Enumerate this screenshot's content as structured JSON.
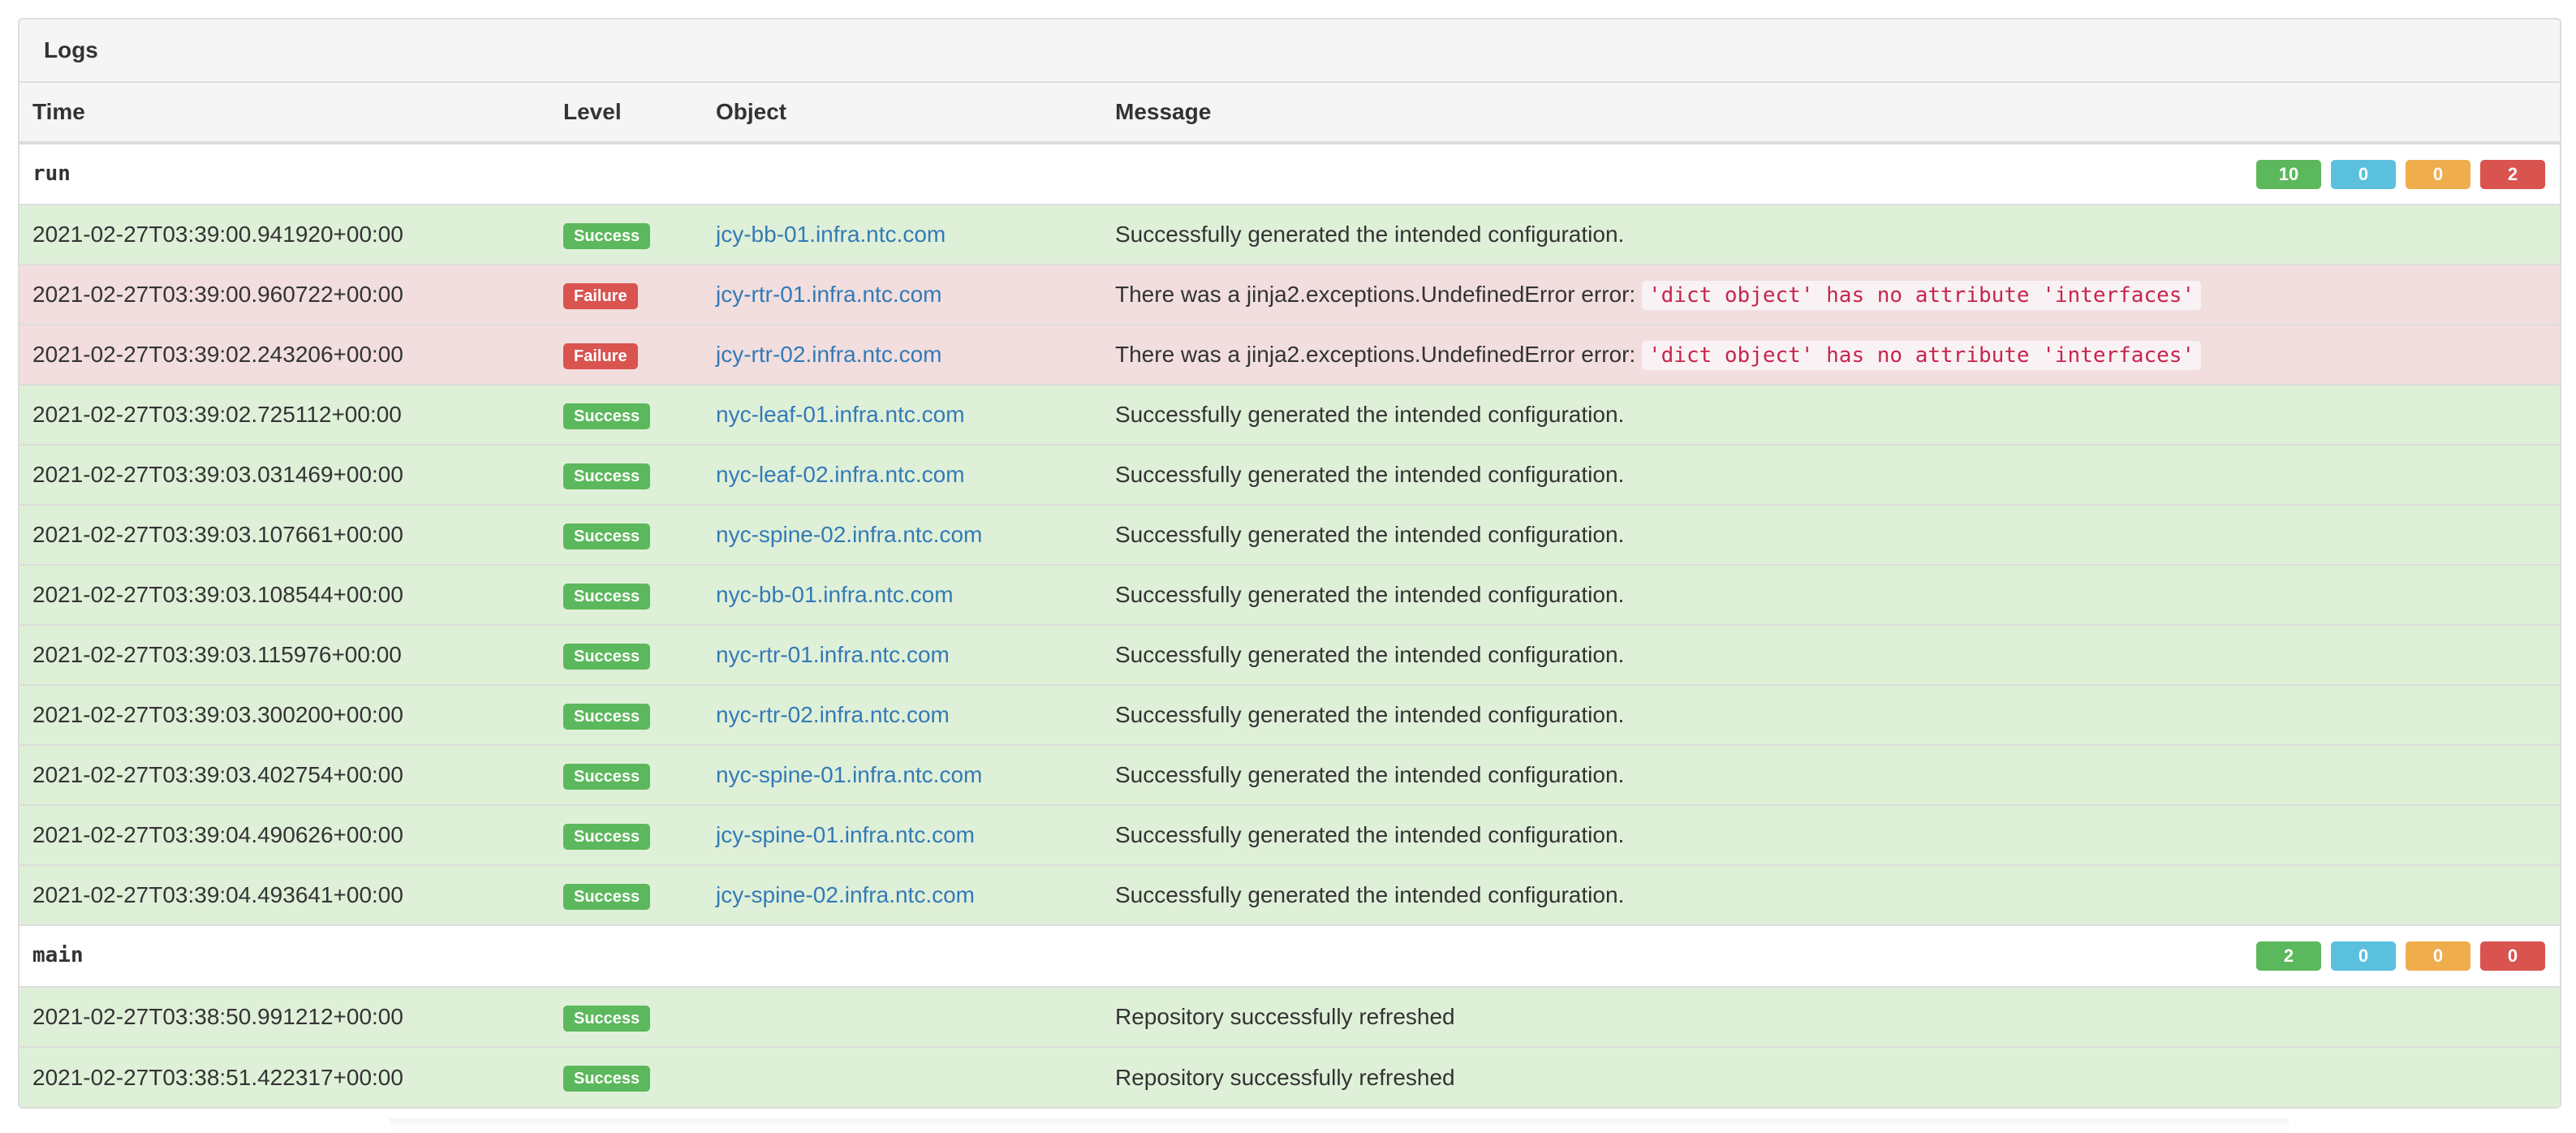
{
  "panel": {
    "title": "Logs"
  },
  "table": {
    "headers": {
      "time": "Time",
      "level": "Level",
      "object": "Object",
      "message": "Message"
    }
  },
  "colors": {
    "success": "#5cb85c",
    "info": "#5bc0de",
    "warning": "#f0ad4e",
    "danger": "#d9534f",
    "success_row": "#dff0d8",
    "failure_row": "#f2dede",
    "link": "#337ab7"
  },
  "groups": [
    {
      "name": "run",
      "counts": [
        "10",
        "0",
        "0",
        "2"
      ],
      "rows": [
        {
          "time": "2021-02-27T03:39:00.941920+00:00",
          "level": "Success",
          "status": "success",
          "object": "jcy-bb-01.infra.ntc.com",
          "message": "Successfully generated the intended configuration.",
          "code": ""
        },
        {
          "time": "2021-02-27T03:39:00.960722+00:00",
          "level": "Failure",
          "status": "failure",
          "object": "jcy-rtr-01.infra.ntc.com",
          "message": "There was a jinja2.exceptions.UndefinedError error:",
          "code": "'dict object' has no attribute 'interfaces'"
        },
        {
          "time": "2021-02-27T03:39:02.243206+00:00",
          "level": "Failure",
          "status": "failure",
          "object": "jcy-rtr-02.infra.ntc.com",
          "message": "There was a jinja2.exceptions.UndefinedError error:",
          "code": "'dict object' has no attribute 'interfaces'"
        },
        {
          "time": "2021-02-27T03:39:02.725112+00:00",
          "level": "Success",
          "status": "success",
          "object": "nyc-leaf-01.infra.ntc.com",
          "message": "Successfully generated the intended configuration.",
          "code": ""
        },
        {
          "time": "2021-02-27T03:39:03.031469+00:00",
          "level": "Success",
          "status": "success",
          "object": "nyc-leaf-02.infra.ntc.com",
          "message": "Successfully generated the intended configuration.",
          "code": ""
        },
        {
          "time": "2021-02-27T03:39:03.107661+00:00",
          "level": "Success",
          "status": "success",
          "object": "nyc-spine-02.infra.ntc.com",
          "message": "Successfully generated the intended configuration.",
          "code": ""
        },
        {
          "time": "2021-02-27T03:39:03.108544+00:00",
          "level": "Success",
          "status": "success",
          "object": "nyc-bb-01.infra.ntc.com",
          "message": "Successfully generated the intended configuration.",
          "code": ""
        },
        {
          "time": "2021-02-27T03:39:03.115976+00:00",
          "level": "Success",
          "status": "success",
          "object": "nyc-rtr-01.infra.ntc.com",
          "message": "Successfully generated the intended configuration.",
          "code": ""
        },
        {
          "time": "2021-02-27T03:39:03.300200+00:00",
          "level": "Success",
          "status": "success",
          "object": "nyc-rtr-02.infra.ntc.com",
          "message": "Successfully generated the intended configuration.",
          "code": ""
        },
        {
          "time": "2021-02-27T03:39:03.402754+00:00",
          "level": "Success",
          "status": "success",
          "object": "nyc-spine-01.infra.ntc.com",
          "message": "Successfully generated the intended configuration.",
          "code": ""
        },
        {
          "time": "2021-02-27T03:39:04.490626+00:00",
          "level": "Success",
          "status": "success",
          "object": "jcy-spine-01.infra.ntc.com",
          "message": "Successfully generated the intended configuration.",
          "code": ""
        },
        {
          "time": "2021-02-27T03:39:04.493641+00:00",
          "level": "Success",
          "status": "success",
          "object": "jcy-spine-02.infra.ntc.com",
          "message": "Successfully generated the intended configuration.",
          "code": ""
        }
      ]
    },
    {
      "name": "main",
      "counts": [
        "2",
        "0",
        "0",
        "0"
      ],
      "rows": [
        {
          "time": "2021-02-27T03:38:50.991212+00:00",
          "level": "Success",
          "status": "success",
          "object": "",
          "message": "Repository successfully refreshed",
          "code": ""
        },
        {
          "time": "2021-02-27T03:38:51.422317+00:00",
          "level": "Success",
          "status": "success",
          "object": "",
          "message": "Repository successfully refreshed",
          "code": ""
        }
      ]
    }
  ]
}
